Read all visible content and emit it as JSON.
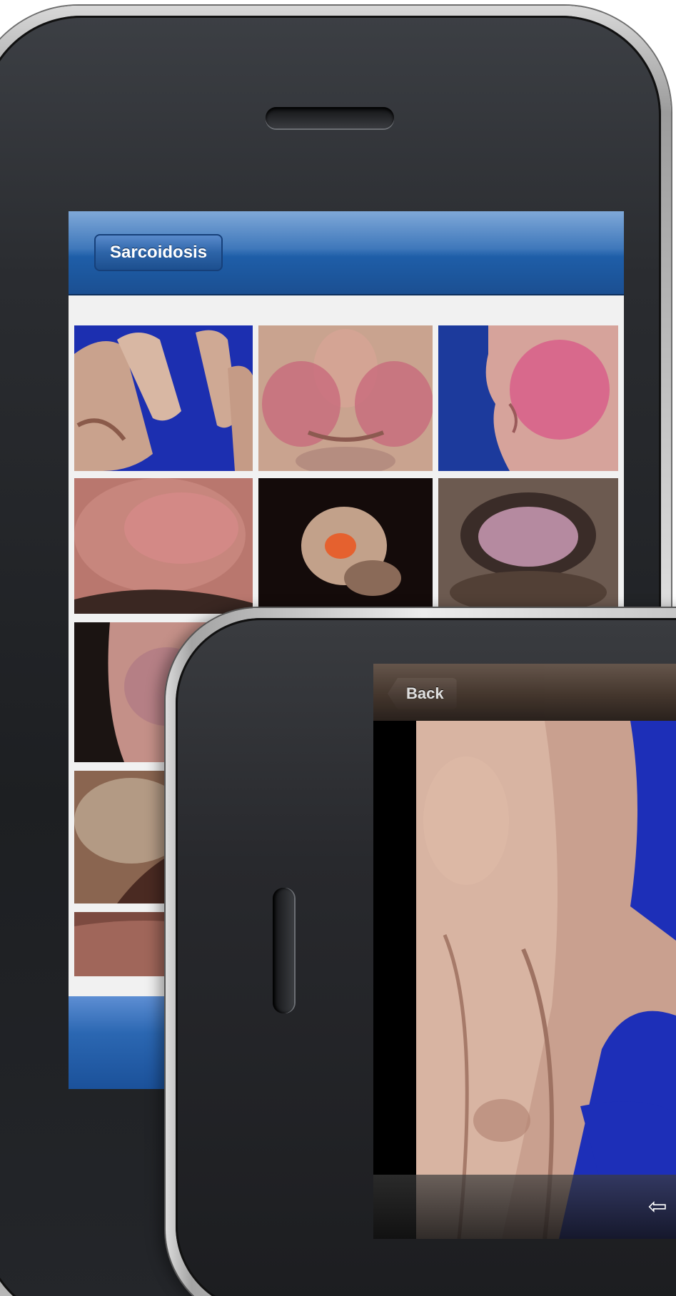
{
  "gallery_screen": {
    "nav_title": "Sarcoidosis",
    "thumbnails": [
      {
        "subject": "hand on blue background"
      },
      {
        "subject": "face with nose and cheek lesion"
      },
      {
        "subject": "face profile on blue background"
      },
      {
        "subject": "forehead skin lesion"
      },
      {
        "subject": "dark lesion with orange center"
      },
      {
        "subject": "lesion around mouth"
      },
      {
        "subject": "facial lesion"
      },
      {
        "subject": "skin fold lesion"
      },
      {
        "subject": "skin lesion"
      }
    ]
  },
  "detail_screen": {
    "back_label": "Back",
    "toolbar_icon": "arrow-left-icon"
  },
  "colors": {
    "nav_blue": "#2b67b2",
    "detail_nav_brown": "#4a3b31",
    "photo_blue": "#1d2fb8"
  }
}
